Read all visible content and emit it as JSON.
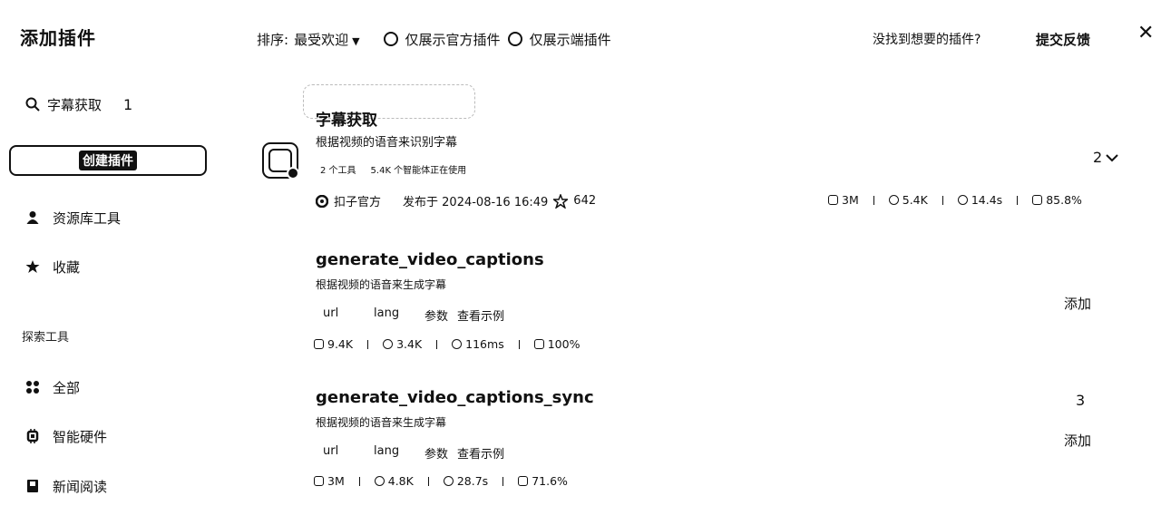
{
  "header": {
    "title": "添加插件",
    "sort_label": "排序:",
    "sort_value": "最受欢迎",
    "filter_official": "仅展示官方插件",
    "filter_client": "仅展示端插件",
    "not_found": "没找到想要的插件?",
    "feedback": "提交反馈"
  },
  "sidebar": {
    "search_value": "字幕获取",
    "search_annotation": "1",
    "create_button": "创建插件",
    "items": [
      {
        "label": "资源库工具",
        "icon": "person-icon"
      },
      {
        "label": "收藏",
        "icon": "star-icon"
      }
    ],
    "explore_label": "探索工具",
    "explore_items": [
      {
        "label": "全部",
        "icon": "grid-icon"
      },
      {
        "label": "智能硬件",
        "icon": "chip-icon"
      },
      {
        "label": "新闻阅读",
        "icon": "book-icon"
      }
    ]
  },
  "plugin": {
    "name": "字幕获取",
    "description": "根据视频的语音来识别字幕",
    "tools_count": "2 个工具",
    "agents_using": "5.4K 个智能体正在使用",
    "expand_label": "2",
    "publisher": "扣子官方",
    "published": "发布于 2024-08-16 16:49",
    "stars": "642",
    "stats": {
      "calls": "3M",
      "bots": "5.4K",
      "latency": "14.4s",
      "success": "85.8%"
    }
  },
  "tools": [
    {
      "name": "generate_video_captions",
      "description": "根据视频的语音来生成字幕",
      "params": [
        "url",
        "lang",
        "参数"
      ],
      "example_link": "查看示例",
      "stats": {
        "calls": "9.4K",
        "bots": "3.4K",
        "latency": "116ms",
        "success": "100%"
      },
      "add_label": "添加"
    },
    {
      "name": "generate_video_captions_sync",
      "description": "根据视频的语音来生成字幕",
      "params": [
        "url",
        "lang",
        "参数"
      ],
      "example_link": "查看示例",
      "stats": {
        "calls": "3M",
        "bots": "4.8K",
        "latency": "28.7s",
        "success": "71.6%"
      },
      "add_label": "添加",
      "annotation": "3"
    }
  ]
}
